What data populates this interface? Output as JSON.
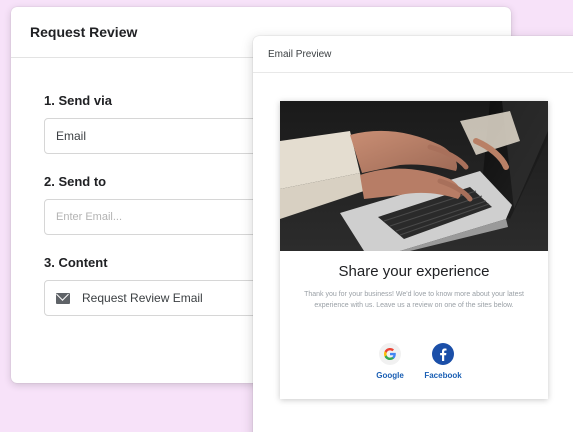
{
  "request_review": {
    "title": "Request Review",
    "steps": [
      {
        "label": "1. Send via",
        "value": "Email"
      },
      {
        "label": "2. Send to",
        "placeholder": "Enter Email..."
      },
      {
        "label": "3. Content",
        "value": "Request Review Email",
        "icon": "mail-icon"
      }
    ]
  },
  "email_preview": {
    "title": "Email Preview",
    "heading": "Share your experience",
    "body": "Thank you for your business! We'd love to know more about your latest experience with us. Leave us a review on one of the sites below.",
    "socials": [
      {
        "name": "Google",
        "icon": "google-icon"
      },
      {
        "name": "Facebook",
        "icon": "facebook-icon"
      }
    ]
  },
  "colors": {
    "background": "#f7e2f9",
    "link": "#1a5fb4",
    "facebook": "#1b4fa8"
  }
}
